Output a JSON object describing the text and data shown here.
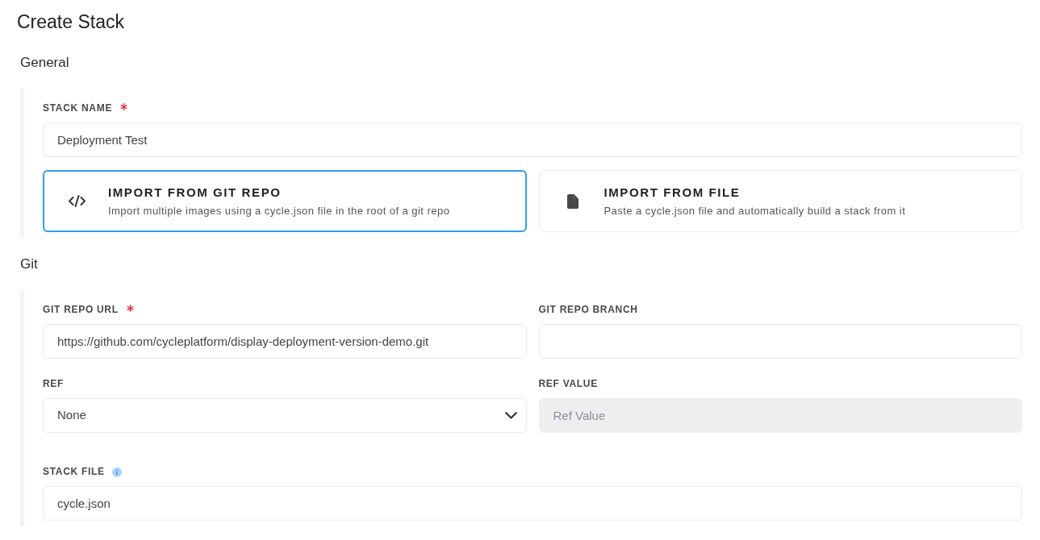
{
  "page": {
    "title": "Create Stack"
  },
  "sections": [
    {
      "heading": "General",
      "rows": [
        {
          "kind": "fields",
          "fields": [
            {
              "kind": "text",
              "label": "STACK NAME",
              "required": true,
              "info": false,
              "disabled": false,
              "value": "Deployment Test"
            }
          ]
        },
        {
          "kind": "options",
          "options": [
            {
              "kind": "git",
              "title": "IMPORT FROM GIT REPO",
              "description": "Import multiple images using a cycle.json file in the root of a git repo",
              "selected": true
            },
            {
              "kind": "file",
              "title": "IMPORT FROM FILE",
              "description": "Paste a cycle.json file and automatically build a stack from it",
              "selected": false
            }
          ]
        }
      ]
    },
    {
      "heading": "Git",
      "rows": [
        {
          "kind": "fields",
          "fields": [
            {
              "kind": "text",
              "label": "GIT REPO URL",
              "required": true,
              "info": false,
              "disabled": false,
              "value": "https://github.com/cycleplatform/display-deployment-version-demo.git"
            },
            {
              "kind": "text",
              "label": "GIT REPO BRANCH",
              "required": false,
              "info": false,
              "disabled": false
            }
          ]
        },
        {
          "kind": "fields",
          "fields": [
            {
              "kind": "select",
              "label": "REF",
              "required": false,
              "info": false,
              "disabled": false,
              "value": "None"
            },
            {
              "kind": "text",
              "label": "REF VALUE",
              "required": false,
              "info": false,
              "disabled": true,
              "placeholder": "Ref Value"
            }
          ]
        },
        {
          "kind": "fields",
          "fields": [
            {
              "kind": "text",
              "label": "STACK FILE",
              "required": false,
              "info": true,
              "disabled": false,
              "value": "cycle.json"
            }
          ]
        }
      ]
    }
  ]
}
